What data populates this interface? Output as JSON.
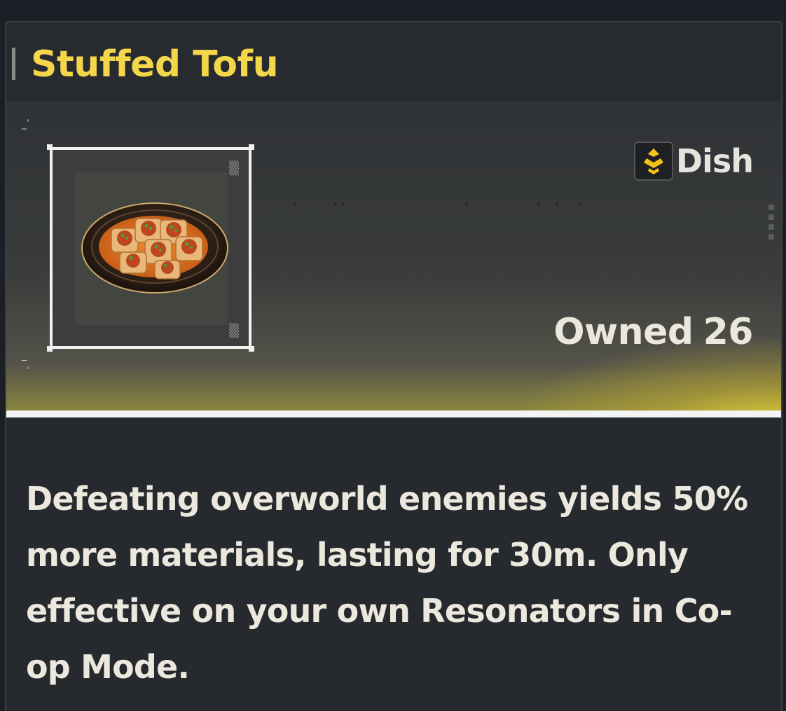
{
  "item": {
    "name": "Stuffed Tofu",
    "category": "Dish",
    "owned_label": "Owned",
    "owned_count": "26",
    "description": "Defeating overworld enemies yields 50% more materials, lasting for 30m. Only effective on your own Resonators in Co-op Mode."
  },
  "colors": {
    "title": "#f3d64a",
    "accent_glow": "#e6d23c",
    "text": "#ede8dd"
  },
  "icons": {
    "item_image": "stuffed-tofu-plate",
    "category_icon": "dish-icon"
  }
}
